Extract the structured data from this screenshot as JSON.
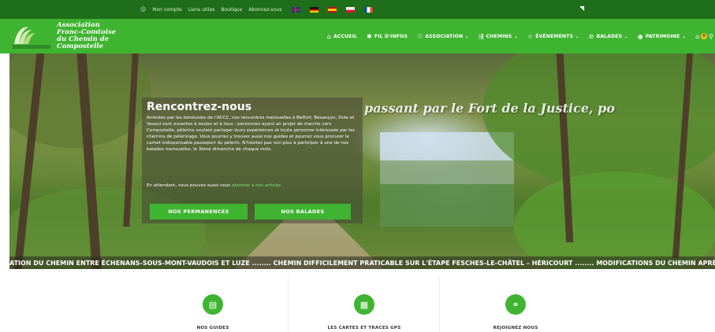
{
  "topbar": {
    "links": [
      "Mon compte",
      "Liens utiles",
      "Boutique",
      "Abonnez-vous"
    ],
    "flags": [
      "flag-uk",
      "flag-de",
      "flag-es",
      "flag-pl",
      "flag-fr"
    ],
    "rss_icon": "rss-icon"
  },
  "brand": {
    "line1": "Association",
    "line2": "Franc-Comtoise",
    "line3": "du Chemin de",
    "line4": "Compostelle"
  },
  "nav": [
    {
      "icon": "home-icon",
      "glyph": "⌂",
      "label": "ACCUEIL"
    },
    {
      "icon": "pin-icon",
      "glyph": "✱",
      "label": "FIL D'INFOS"
    },
    {
      "icon": "people-icon",
      "glyph": "☉",
      "label": "ASSOCIATION ⌄"
    },
    {
      "icon": "signpost-icon",
      "glyph": "⇶",
      "label": "CHEMINS ⌄"
    },
    {
      "icon": "star-icon",
      "glyph": "☆",
      "label": "ÉVÉNEMENTS ⌄"
    },
    {
      "icon": "compass-icon",
      "glyph": "⊘",
      "label": "BALADES ⌄"
    },
    {
      "icon": "eye-icon",
      "glyph": "◉",
      "label": "PATRIMOINE ⌄"
    }
  ],
  "cart": {
    "count": "0"
  },
  "hero": {
    "overlay_title": "passant par le Fort de la Justice, po",
    "panel_title": "Rencontrez-nous",
    "panel_text": "Animées par les bénévoles de l'ACCC, nos rencontres mensuelles à Belfort, Besançon, Dole et Vesoul sont ouvertes à toutes et à tous : personnes ayant un projet de marche vers Compostelle, pèlerins voulant partager leurs expériences et toute personne intéressée par les chemins de pèlerinage. Vous pourrez y trouver aussi nos guides et pourrez vous procurer le carnet indispensable passeport du pèlerin. N'hésitez pas non plus à participer à une de nos balades mensuelles, le 3ème dimanche de chaque mois.",
    "panel_text2_prefix": "En attendant, vous pouvez aussi vous ",
    "panel_text2_link": "abonner à nos articles.",
    "btn1": "NOS PERMANENCES",
    "btn2": "NOS BALADES"
  },
  "ticker": "ATION DU CHEMIN ENTRE ÉCHENANS-SOUS-MONT-VAUDOIS ET LUZE ........ CHEMIN DIFFICILEMENT PRATICABLE SUR L'ÉTAPE FESCHES-LE-CHÂTEL – HÉRICOURT ........ MODIFICATIONS DU CHEMIN APRÈS BE",
  "features": [
    {
      "icon": "book-icon",
      "glyph": "▤",
      "label": "NOS GUIDES"
    },
    {
      "icon": "map-icon",
      "glyph": "▦",
      "label": "LES CARTES ET TRACES GPS"
    },
    {
      "icon": "handshake-icon",
      "glyph": "⚭",
      "label": "REJOIGNEZ NOUS"
    }
  ],
  "colors": {
    "green": "#3fb431",
    "dark_green": "#1f6e1a"
  }
}
